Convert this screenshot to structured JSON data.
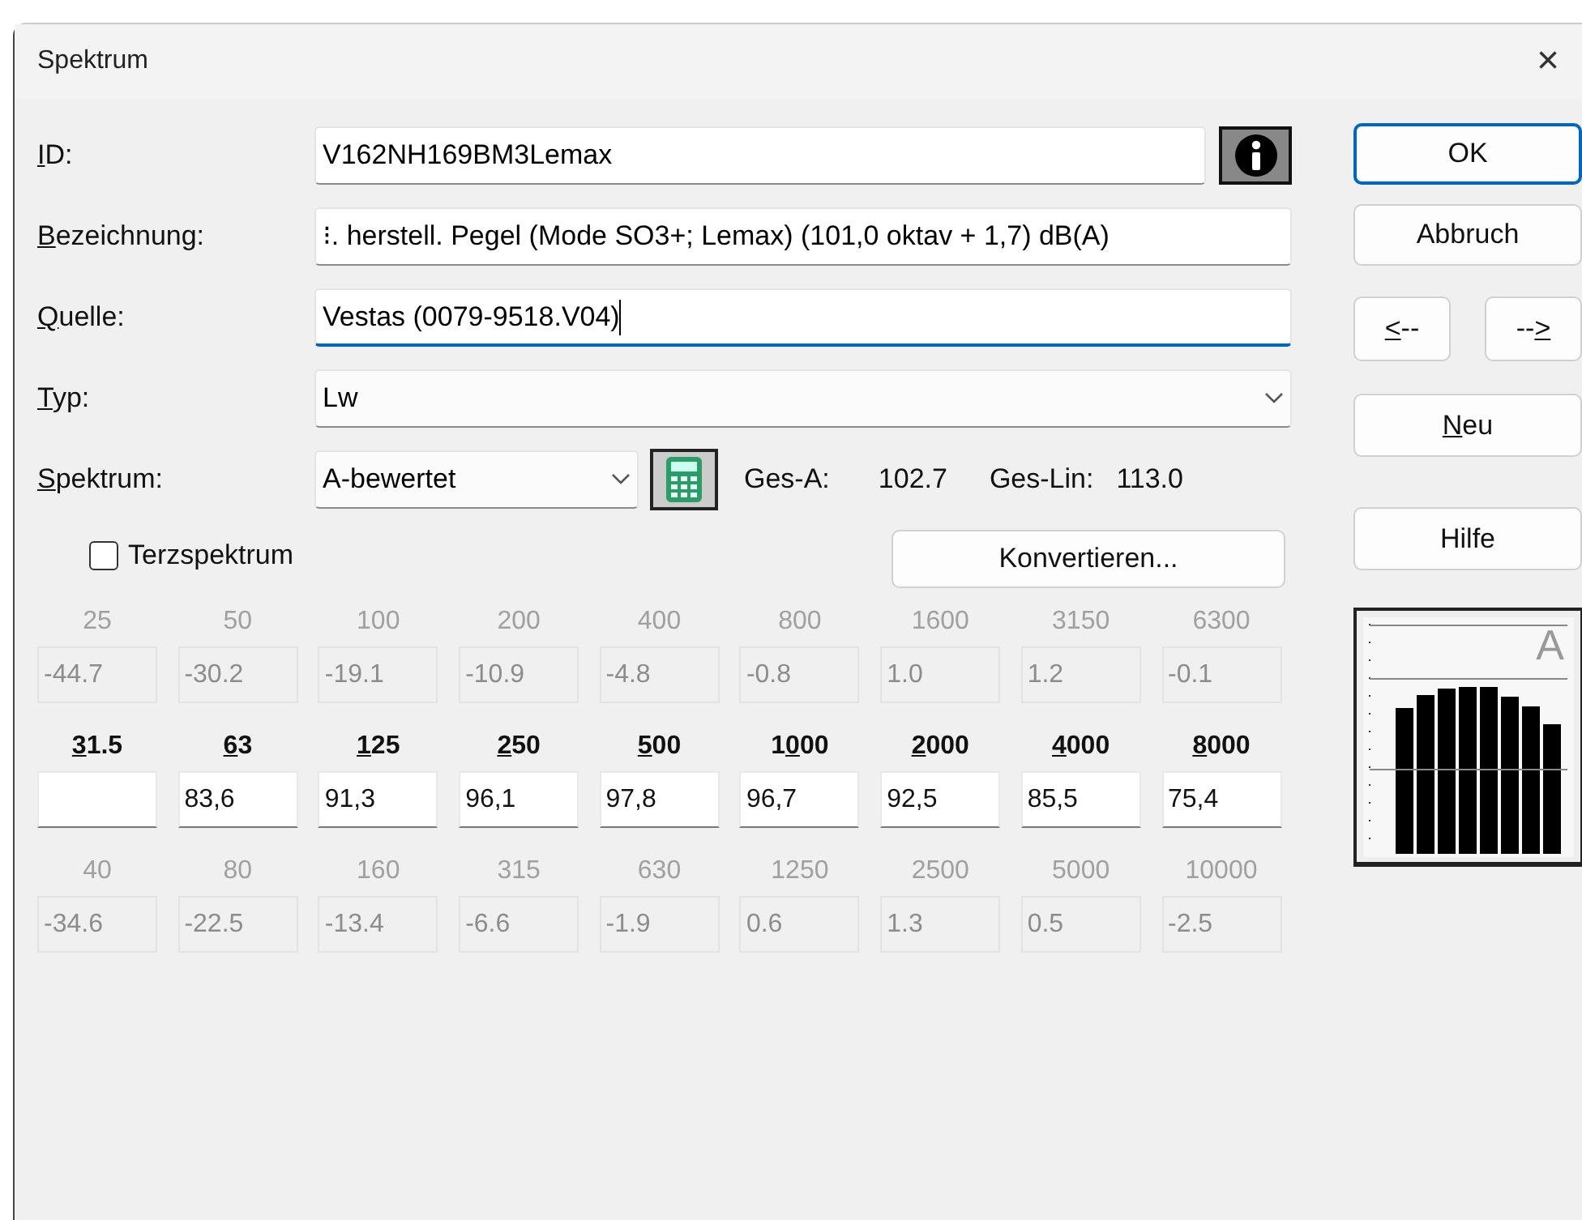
{
  "window": {
    "title": "Spektrum",
    "close": "×"
  },
  "fields": [
    {
      "kind": "text",
      "label": {
        "key": "I",
        "post": "D:"
      },
      "value": "V162NH169BM3Lemax",
      "info": true,
      "focused": false
    },
    {
      "kind": "text",
      "label": {
        "key": "B",
        "post": "ezeichnung:"
      },
      "value": "⁝. herstell. Pegel (Mode SO3+; Lemax) (101,0 oktav + 1,7) dB(A)",
      "focused": false
    },
    {
      "kind": "text",
      "label": {
        "key": "Q",
        "post": "uelle:"
      },
      "value": "Vestas (0079-9518.V04)",
      "focused": true
    },
    {
      "kind": "select",
      "label": {
        "key": "T",
        "post": "yp:"
      },
      "value": "Lw",
      "focused": false
    }
  ],
  "spectrum": {
    "label": {
      "key": "S",
      "post": "pektrum:"
    },
    "value": "A-bewertet",
    "ges_a_label": "Ges-A:",
    "ges_a": "102.7",
    "ges_lin_label": "Ges-Lin:",
    "ges_lin": "113.0"
  },
  "terz": {
    "label": "Terzspektrum",
    "checked": false
  },
  "convert_button": "Konvertieren...",
  "buttons": [
    {
      "kind": "default",
      "label": {
        "post": "OK"
      }
    },
    {
      "kind": "normal",
      "label": {
        "post": "Abbruch"
      }
    },
    {
      "kind": "nav",
      "label": {
        "key": "<",
        "post": "--"
      }
    },
    {
      "kind": "nav",
      "label": {
        "pre": "--",
        "key": ">"
      }
    },
    {
      "kind": "normal",
      "label": {
        "key": "N",
        "post": "eu"
      }
    },
    {
      "kind": "spaced",
      "label": {
        "post": "Hilfe"
      }
    }
  ],
  "bands": [
    {
      "upper": {
        "freq": "25",
        "value": "-44.7"
      },
      "octave": {
        "label": {
          "key": "3",
          "post": "1.5"
        }
      },
      "lower": {
        "freq": "40",
        "value": "-34.6"
      }
    },
    {
      "upper": {
        "freq": "50",
        "value": "-30.2"
      },
      "octave": {
        "label": {
          "key": "6",
          "post": "3"
        },
        "value": "83,6"
      },
      "lower": {
        "freq": "80",
        "value": "-22.5"
      }
    },
    {
      "upper": {
        "freq": "100",
        "value": "-19.1"
      },
      "octave": {
        "label": {
          "key": "1",
          "post": "25"
        },
        "value": "91,3"
      },
      "lower": {
        "freq": "160",
        "value": "-13.4"
      }
    },
    {
      "upper": {
        "freq": "200",
        "value": "-10.9"
      },
      "octave": {
        "label": {
          "key": "2",
          "post": "50"
        },
        "value": "96,1"
      },
      "lower": {
        "freq": "315",
        "value": "-6.6"
      }
    },
    {
      "upper": {
        "freq": "400",
        "value": "-4.8"
      },
      "octave": {
        "label": {
          "key": "5",
          "post": "00"
        },
        "value": "97,8"
      },
      "lower": {
        "freq": "630",
        "value": "-1.9"
      }
    },
    {
      "upper": {
        "freq": "800",
        "value": "-0.8"
      },
      "octave": {
        "label": {
          "pre": "1",
          "key": "0",
          "post": "00"
        },
        "value": "96,7"
      },
      "lower": {
        "freq": "1250",
        "value": "0.6"
      }
    },
    {
      "upper": {
        "freq": "1600",
        "value": "1.0"
      },
      "octave": {
        "label": {
          "key": "2",
          "post": "000"
        },
        "value": "92,5"
      },
      "lower": {
        "freq": "2500",
        "value": "1.3"
      }
    },
    {
      "upper": {
        "freq": "3150",
        "value": "1.2"
      },
      "octave": {
        "label": {
          "key": "4",
          "post": "000"
        },
        "value": "85,5"
      },
      "lower": {
        "freq": "5000",
        "value": "0.5"
      }
    },
    {
      "upper": {
        "freq": "6300",
        "value": "-0.1"
      },
      "octave": {
        "label": {
          "key": "8",
          "post": "000"
        },
        "value": "75,4"
      },
      "lower": {
        "freq": "10000",
        "value": "-2.5"
      }
    }
  ],
  "preview": {
    "letter": "A"
  }
}
